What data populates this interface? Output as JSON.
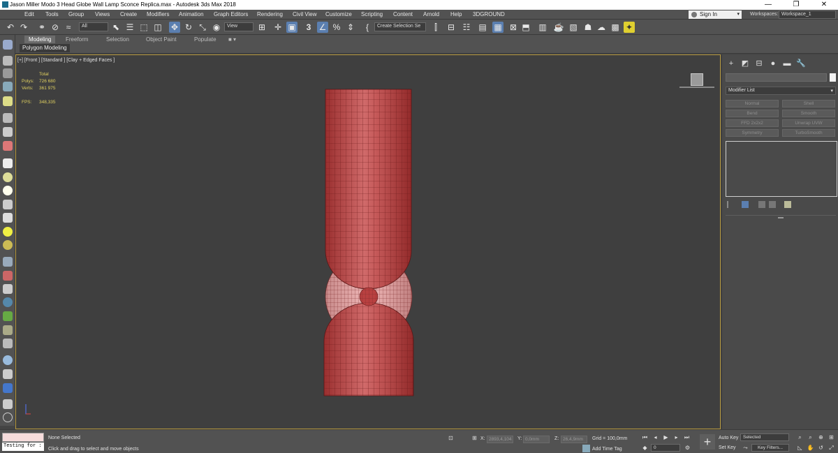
{
  "window": {
    "title": "Jason Miller Modo 3 Head Globe Wall Lamp Sconce Replica.max - Autodesk 3ds Max 2018",
    "minimize": "—",
    "restore": "❐",
    "close": "✕"
  },
  "menu": {
    "items": [
      "Edit",
      "Tools",
      "Group",
      "Views",
      "Create",
      "Modifiers",
      "Animation",
      "Graph Editors",
      "Rendering",
      "Civil View",
      "Customize",
      "Scripting",
      "Content",
      "Arnold",
      "Help",
      "3DGROUND"
    ],
    "sign_in": "Sign In",
    "workspaces_label": "Workspaces:",
    "workspace_value": "Workspace_1"
  },
  "toolbar": {
    "selection_filter": "All",
    "ref_coord": "View",
    "named_selection": "Create Selection Se",
    "snap_label": "3",
    "percent_snap": "%",
    "icons": [
      "undo-icon",
      "redo-icon",
      "link-icon",
      "unlink-icon",
      "bind-spacewarp-icon",
      "select-object-icon",
      "select-by-name-icon",
      "rect-selection-icon",
      "window-crossing-icon",
      "select-move-icon",
      "select-rotate-icon",
      "select-scale-icon",
      "place-icon",
      "pivot-icon",
      "select-manipulate-icon",
      "keyboard-shortcut-icon",
      "snap-icon",
      "angle-snap-icon",
      "percent-snap-icon",
      "spinner-snap-icon",
      "edit-named-sets-icon",
      "mirror-icon",
      "align-icon",
      "layer-explorer-icon",
      "toggle-ribbon-icon",
      "curve-editor-icon",
      "schematic-view-icon",
      "material-editor-icon",
      "render-setup-icon",
      "rendered-frame-icon",
      "render-production-icon",
      "render-iterative-icon",
      "render-online-icon",
      "render-shortcut-icon"
    ]
  },
  "ribbon": {
    "tabs": [
      "Modeling",
      "Freeform",
      "Selection",
      "Object Paint",
      "Populate"
    ],
    "active_tab": "Modeling",
    "sub_label": "Polygon Modeling",
    "extra": "■ ▾"
  },
  "viewport": {
    "label": "[+] [Front ] [Standard ] [Clay + Edged Faces ]",
    "stats": {
      "total_label": "Total",
      "polys_label": "Polys:",
      "polys_value": "726 680",
      "verts_label": "Verts:",
      "verts_value": "361 975",
      "fps_label": "FPS:",
      "fps_value": "348,335"
    },
    "mesh_color": "#c04040",
    "wire_color": "#6a1a1a",
    "globe_color": "#e0a0a0"
  },
  "command_panel": {
    "modifier_list": "Modifier List",
    "modifier_buttons": [
      "Normal",
      "Shell",
      "Bend",
      "Smooth",
      "FFD 2x2x2",
      "Unwrap UVW",
      "Symmetry",
      "TurboSmooth"
    ]
  },
  "status": {
    "script_text": "Testing for :",
    "selection": "None Selected",
    "prompt": "Click and drag to select and move objects",
    "x_label": "X:",
    "x_value": "2893,4,104",
    "y_label": "Y:",
    "y_value": "0,0mm",
    "z_label": "Z:",
    "z_value": "26,4,9mm",
    "grid": "Grid = 100,0mm",
    "add_time_tag": "Add Time Tag",
    "frame": "0",
    "auto_key": "Auto Key",
    "set_key": "Set Key",
    "key_mode": "Selected",
    "key_filters": "Key Filters..."
  }
}
